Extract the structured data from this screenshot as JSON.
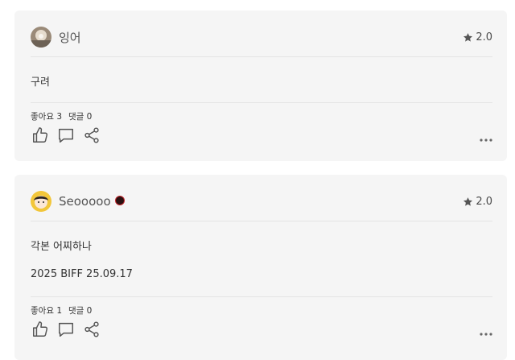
{
  "reviews": [
    {
      "username": "잉어",
      "rating": "2.0",
      "text_lines": [
        "구려"
      ],
      "likes_label": "좋아요 3",
      "comments_label": "댓글 0",
      "has_badge": false
    },
    {
      "username": "Seooooo",
      "rating": "2.0",
      "text_lines": [
        "각본 어찌하나",
        "2025 BIFF 25.09.17"
      ],
      "likes_label": "좋아요 1",
      "comments_label": "댓글 0",
      "has_badge": true
    }
  ],
  "icons": {
    "star": "star-icon",
    "like": "thumbs-up-icon",
    "comment": "comment-icon",
    "share": "share-icon",
    "more": "more-icon"
  },
  "colors": {
    "card_bg": "#f5f5f5",
    "divider": "#e4e4e4",
    "icon": "#555555"
  }
}
